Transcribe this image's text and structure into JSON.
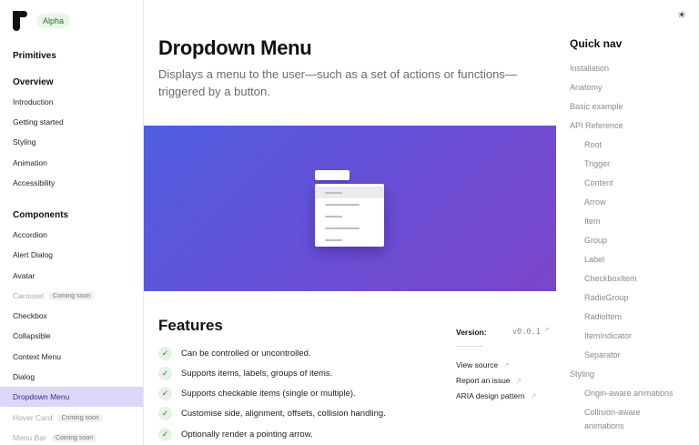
{
  "sidebar": {
    "badge": "Alpha",
    "primitives_heading": "Primitives",
    "overview_heading": "Overview",
    "overview_items": [
      "Introduction",
      "Getting started",
      "Styling",
      "Animation",
      "Accessibility"
    ],
    "components_heading": "Components",
    "components": [
      {
        "label": "Accordion",
        "soon": ""
      },
      {
        "label": "Alert Dialog",
        "soon": ""
      },
      {
        "label": "Avatar",
        "soon": ""
      },
      {
        "label": "Carousel",
        "soon": "Coming soon"
      },
      {
        "label": "Checkbox",
        "soon": ""
      },
      {
        "label": "Collapsible",
        "soon": ""
      },
      {
        "label": "Context Menu",
        "soon": ""
      },
      {
        "label": "Dialog",
        "soon": ""
      },
      {
        "label": "Dropdown Menu",
        "soon": ""
      },
      {
        "label": "Hover Card",
        "soon": "Coming soon"
      },
      {
        "label": "Menu Bar",
        "soon": "Coming soon"
      }
    ]
  },
  "main": {
    "title": "Dropdown Menu",
    "description": "Displays a menu to the user—such as a set of actions or functions—triggered by a button.",
    "features_heading": "Features",
    "features": [
      "Can be controlled or uncontrolled.",
      "Supports items, labels, groups of items.",
      "Supports checkable items (single or multiple).",
      "Customise side, alignment, offsets, collision handling.",
      "Optionally render a pointing arrow."
    ],
    "check_glyph": "✓",
    "version_label": "Version:",
    "version_value": "v0.0.1",
    "external_arrow": "↗",
    "resources": [
      "View source",
      "Report an issue",
      "ARIA design pattern"
    ]
  },
  "quicknav": {
    "title": "Quick nav",
    "theme_icon": "☀",
    "links": [
      {
        "label": "Installation",
        "indent": 0
      },
      {
        "label": "Anatomy",
        "indent": 0
      },
      {
        "label": "Basic example",
        "indent": 0
      },
      {
        "label": "API Reference",
        "indent": 0
      },
      {
        "label": "Root",
        "indent": 1
      },
      {
        "label": "Trigger",
        "indent": 1
      },
      {
        "label": "Content",
        "indent": 1
      },
      {
        "label": "Arrow",
        "indent": 1
      },
      {
        "label": "Item",
        "indent": 1
      },
      {
        "label": "Group",
        "indent": 1
      },
      {
        "label": "Label",
        "indent": 1
      },
      {
        "label": "CheckboxItem",
        "indent": 1
      },
      {
        "label": "RadioGroup",
        "indent": 1
      },
      {
        "label": "RadioItem",
        "indent": 1
      },
      {
        "label": "ItemIndicator",
        "indent": 1
      },
      {
        "label": "Separator",
        "indent": 1
      },
      {
        "label": "Styling",
        "indent": 0
      },
      {
        "label": "Origin-aware animations",
        "indent": 1
      },
      {
        "label": "Collision-aware animations",
        "indent": 1
      }
    ]
  },
  "colors": {
    "accent_active_bg": "#dcd6f7",
    "hero_gradient_start": "#4f5ee0",
    "hero_gradient_end": "#7b45c9",
    "badge_bg": "#e9f6e9"
  }
}
